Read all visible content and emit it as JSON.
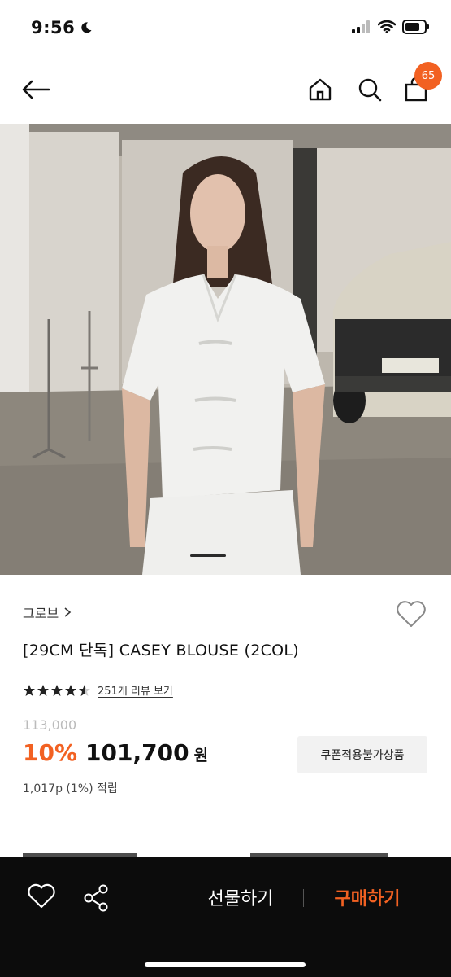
{
  "status_bar": {
    "time": "9:56",
    "icons": [
      "moon-icon",
      "cellular-signal-icon",
      "wifi-icon",
      "battery-icon"
    ]
  },
  "nav": {
    "icons": [
      "back-arrow-icon",
      "home-icon",
      "search-icon",
      "cart-icon"
    ],
    "cart_count": "65"
  },
  "hero": {
    "slide_indicator": "1"
  },
  "product": {
    "brand": "그로브",
    "title": "[29CM 단독] CASEY BLOUSE (2COL)",
    "rating": 4.5,
    "review_link": "251개 리뷰 보기",
    "original_price": "113,000",
    "discount": "10%",
    "sale_price": "101,700",
    "currency": "원",
    "coupon_notice": "쿠폰적용불가상품",
    "points": "1,017p (1%) 적립"
  },
  "bottom_bar": {
    "gift_label": "선물하기",
    "buy_label": "구매하기",
    "icons": [
      "heart-icon",
      "share-icon"
    ]
  },
  "colors": {
    "accent": "#f26122",
    "bottom_bar_bg": "#0c0c0c"
  }
}
